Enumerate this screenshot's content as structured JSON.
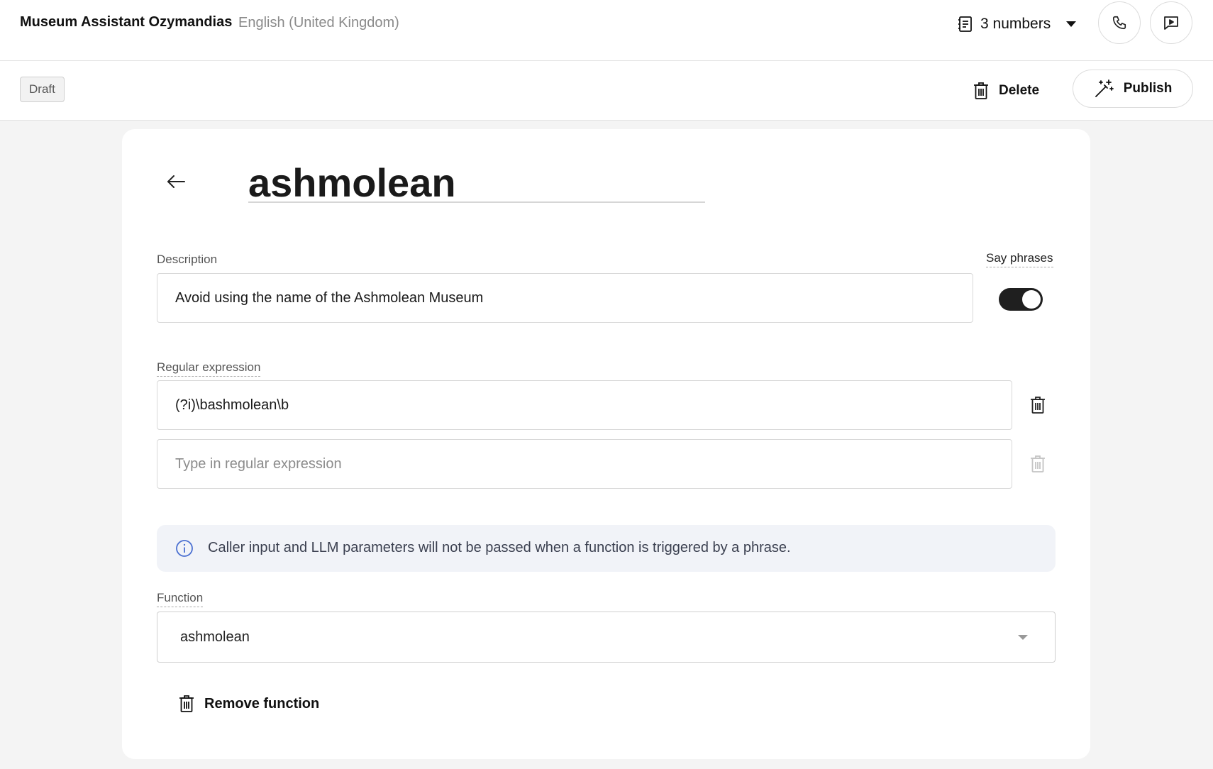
{
  "header": {
    "app_title": "Museum Assistant Ozymandias",
    "locale": "English (United Kingdom)",
    "numbers_label": "3 numbers",
    "icons": {
      "numbers": "list-icon",
      "call": "phone-icon",
      "chat": "chat-icon"
    }
  },
  "toolbar": {
    "status_badge": "Draft",
    "delete_label": "Delete",
    "publish_label": "Publish",
    "icons": {
      "delete": "trash-icon",
      "publish": "magic-wand-icon"
    }
  },
  "editor": {
    "title": "ashmolean",
    "description": {
      "label": "Description",
      "value": "Avoid using the name of the Ashmolean Museum"
    },
    "say_phrases": {
      "label": "Say phrases",
      "enabled": true
    },
    "regex": {
      "label": "Regular expression",
      "entries": [
        {
          "value": "(?i)\\bashmolean\\b"
        },
        {
          "value": "",
          "placeholder": "Type in regular expression"
        }
      ]
    },
    "info": {
      "text": "Caller input and LLM parameters will not be passed when a function is triggered by a phrase.",
      "icon": "info-icon"
    },
    "function": {
      "label": "Function",
      "selected": "ashmolean"
    },
    "remove_function_label": "Remove function"
  },
  "colors": {
    "background": "#f4f4f4",
    "surface": "#ffffff",
    "toggle_on": "#1f1f1f",
    "info_bg": "#f1f3f8",
    "info_icon": "#4a6fd1"
  }
}
